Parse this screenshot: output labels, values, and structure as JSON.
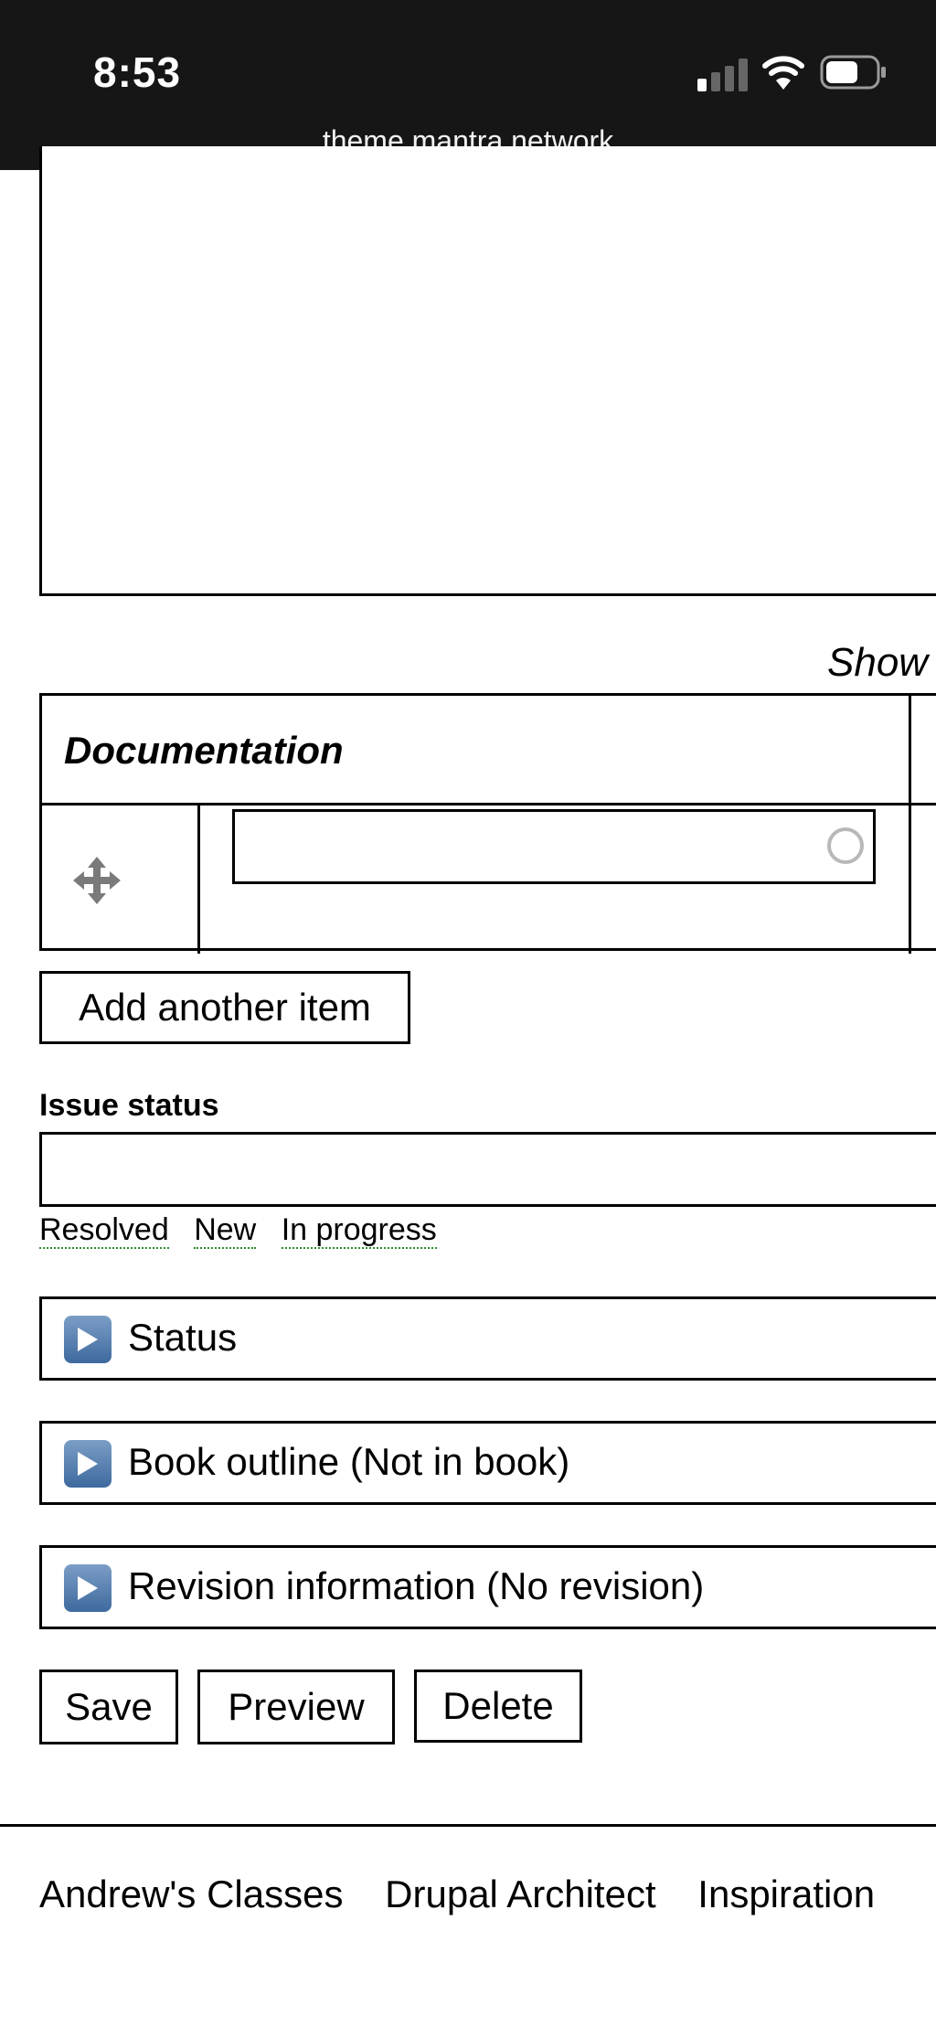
{
  "status_bar": {
    "time": "8:53",
    "url": "theme.mantra.network"
  },
  "table_drag": {
    "show_row_weights": "Show",
    "header": "Documentation"
  },
  "buttons": {
    "add_another_item": "Add another item",
    "save": "Save",
    "preview": "Preview",
    "delete": "Delete"
  },
  "issue_status": {
    "label": "Issue status",
    "value": "",
    "suggestions": [
      "Resolved",
      "New",
      "In progress"
    ]
  },
  "details": [
    {
      "label": "Status"
    },
    {
      "label": "Book outline (Not in book)"
    },
    {
      "label": "Revision information (No revision)"
    }
  ],
  "footer": {
    "links": [
      "Andrew's Classes",
      "Drupal Architect",
      "Inspiration"
    ]
  },
  "colors": {
    "status_bar_bg": "#161616",
    "suggestion_underline": "#2e8b2e",
    "details_icon": "#4f79ab"
  }
}
